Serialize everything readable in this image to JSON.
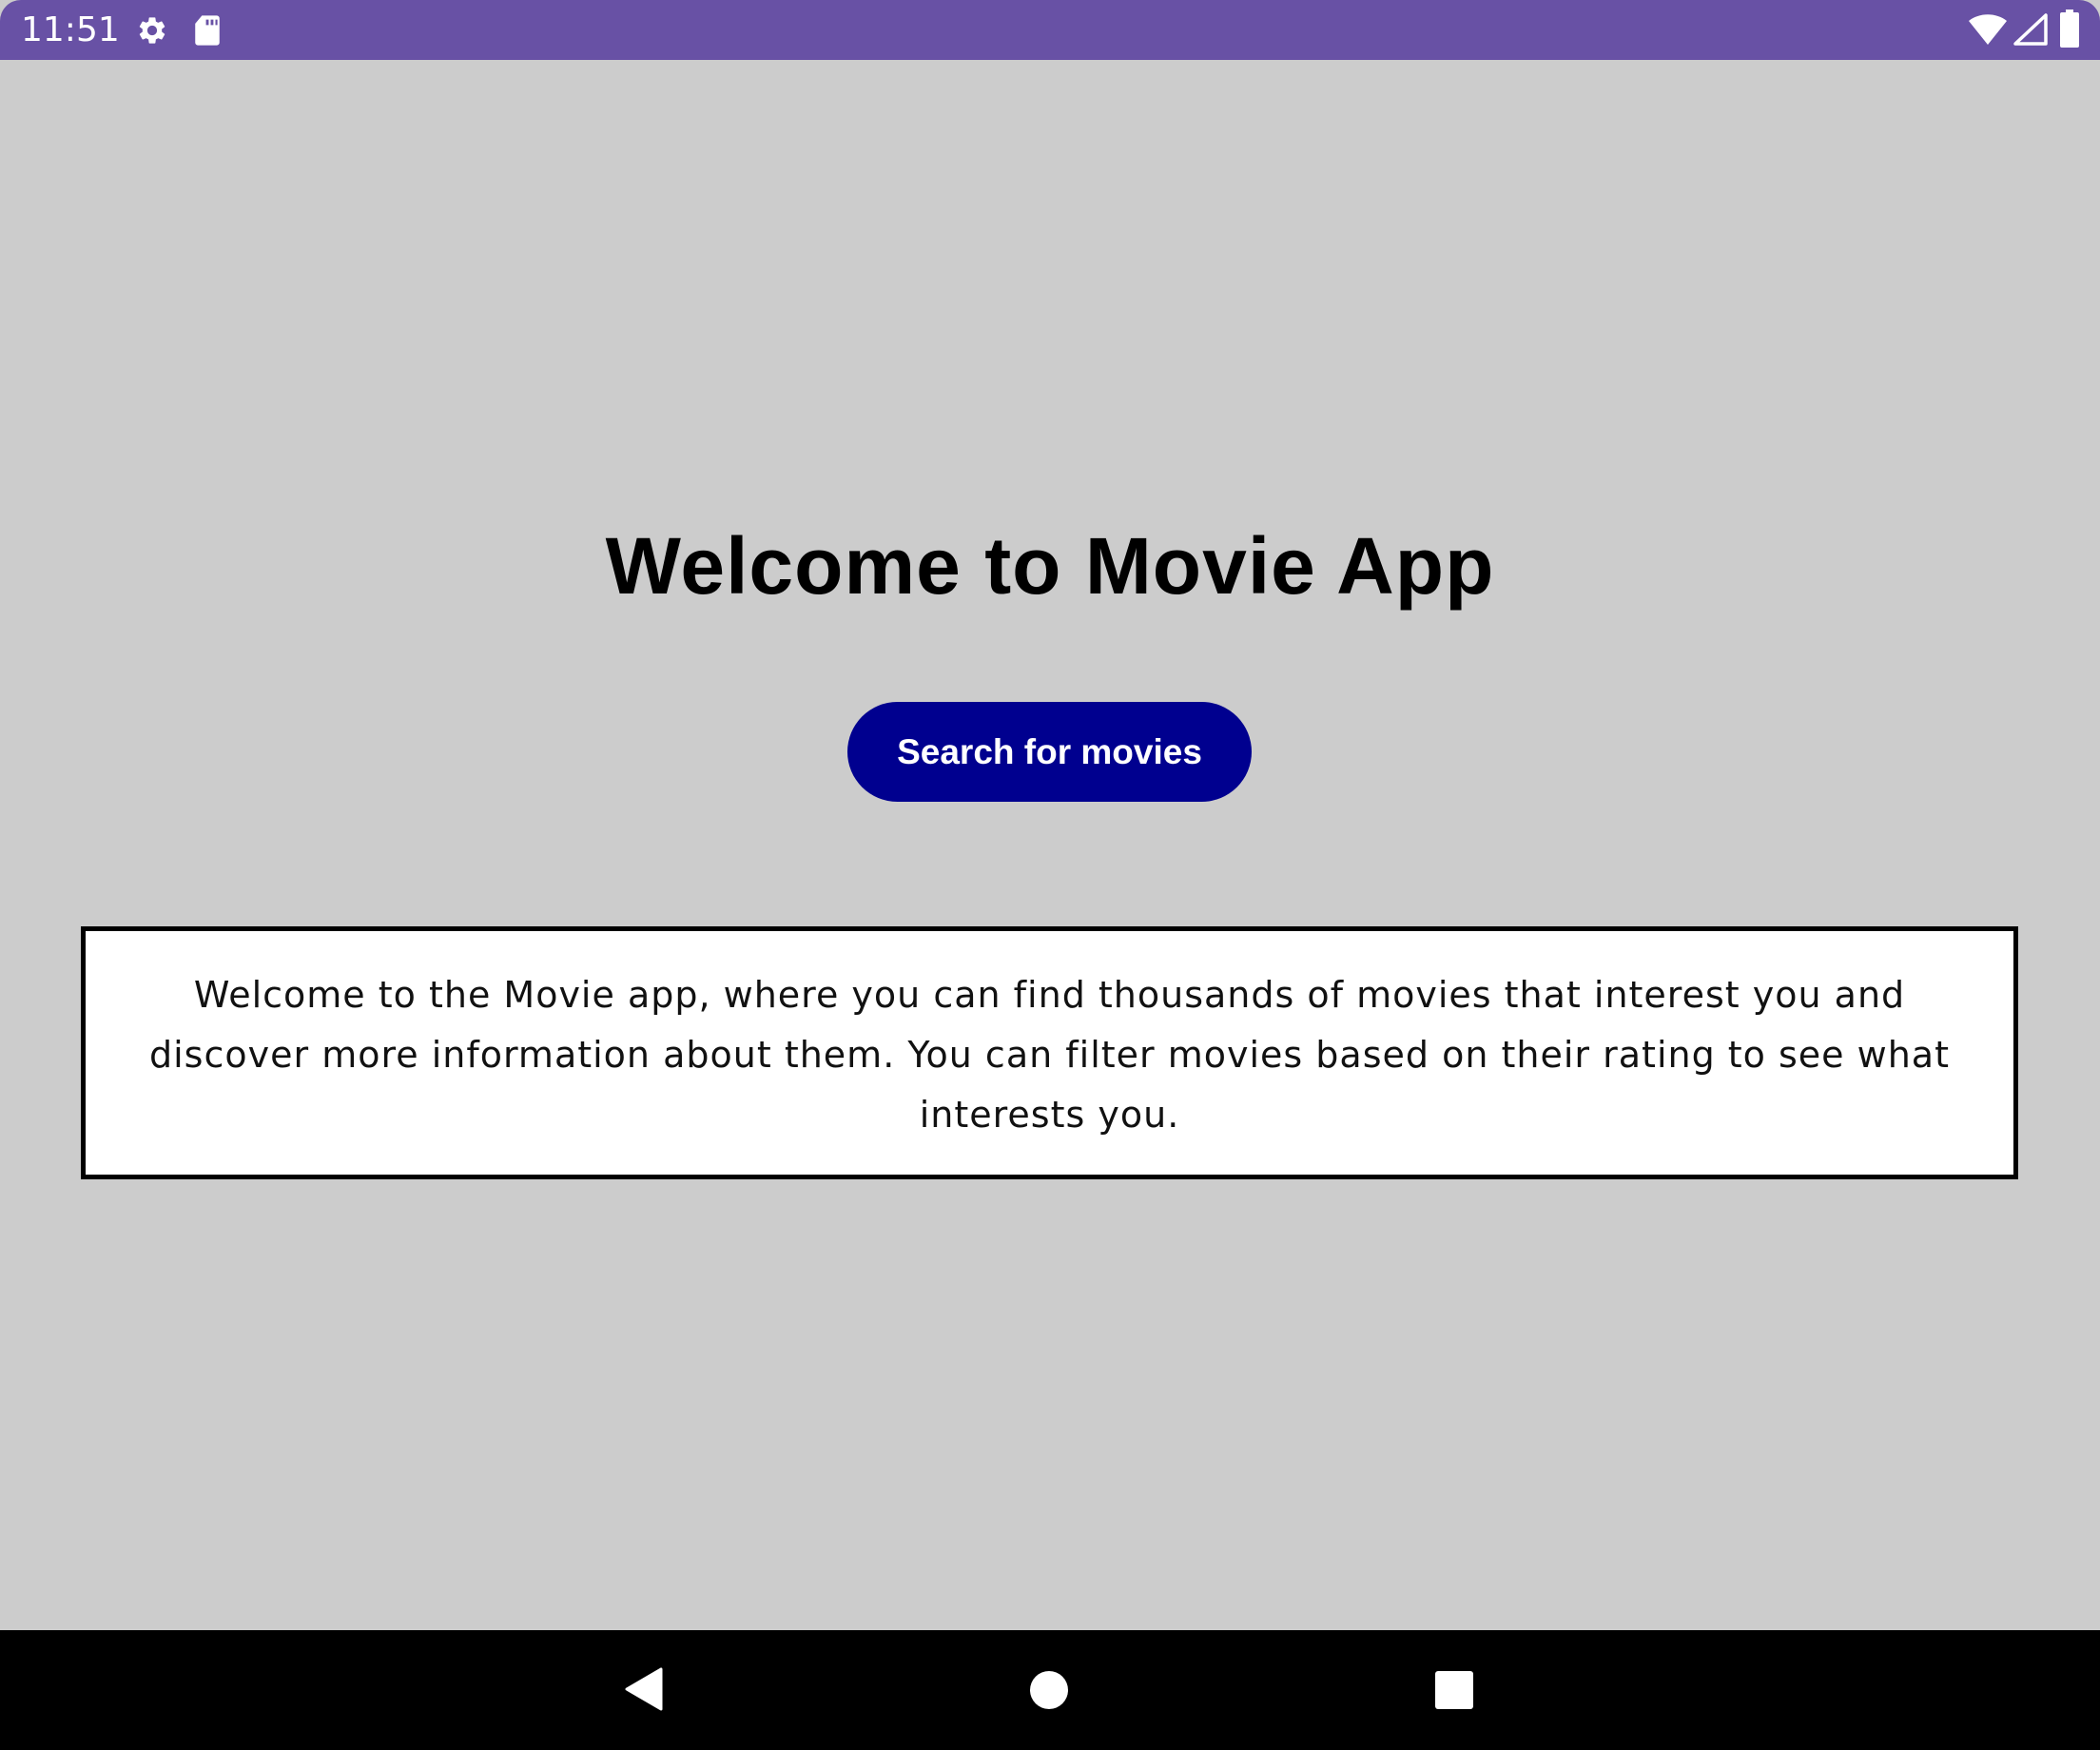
{
  "status_bar": {
    "time": "11:51",
    "icons": [
      "settings-icon",
      "sd-card-icon",
      "wifi-icon",
      "signal-icon",
      "battery-icon"
    ],
    "background": "#6851a5"
  },
  "main": {
    "background": "#cccccc",
    "title": "Welcome to Movie App",
    "search_button_label": "Search for movies",
    "search_button_color": "#00008f",
    "intro_text": "Welcome to the Movie app, where you can find thousands of movies that interest you and discover more information about them. You can filter movies based on their rating to see what interests you."
  },
  "nav_bar": {
    "buttons": [
      "back-icon",
      "home-icon",
      "recents-icon"
    ]
  }
}
